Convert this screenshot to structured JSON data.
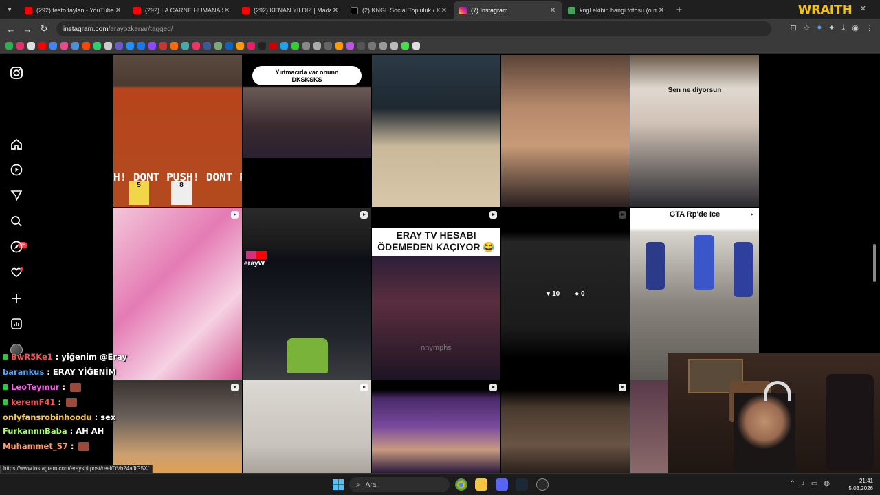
{
  "browser": {
    "tabs": [
      {
        "title": "(292) testo taylan - YouTube",
        "color": "#ff0000"
      },
      {
        "title": "(292) LA CARNE HUMANA SE C",
        "color": "#ff0000"
      },
      {
        "title": "(292) KENAN YILDIZ | Madara C",
        "color": "#ff0000"
      },
      {
        "title": "(2) KNGL Social Topluluk / X",
        "color": "#000000"
      },
      {
        "title": "(7) Instagram",
        "color": "#e1306c"
      },
      {
        "title": "kngl ekibin hangi fotosu (o mu",
        "color": "#46a35e"
      }
    ],
    "close_glyph": "✕",
    "new_tab": "+",
    "url_host": "instagram.com",
    "url_path": "/erayozkenar/tagged/",
    "overlay_logo": "WRAITH"
  },
  "instagram": {
    "notifications_badge": "9+",
    "grid": {
      "tile_captions": {
        "yirtmacida": "Yırtmacıda var onunn",
        "dksksks": "DKSKSKS",
        "sen_ne_diyorsun": "Sen ne diyorsun",
        "gta_rp": "GTA Rp'de Ice",
        "eray_tv_line1": "ERAY TV HESABI",
        "eray_tv_line2": "ÖDEMEDEN KAÇIYOR 😂",
        "dont_push": "H! DONT PUSH! DONT PU",
        "counter_left": "5",
        "counter_right": "8",
        "eray_tag": "erayW",
        "watermark": "nnymphs"
      },
      "hover": {
        "likes": "10",
        "comments": "0"
      }
    }
  },
  "stream": {
    "chat": [
      {
        "user": "BwR5Ke1",
        "msg": "yiğenim @Eray",
        "color": "#ff4d4d",
        "badge": true,
        "emote": false
      },
      {
        "user": "barankus",
        "msg": "ERAY YİĞENİM",
        "color": "#4da6ff",
        "badge": false,
        "emote": false
      },
      {
        "user": "LeoTeymur",
        "msg": "",
        "color": "#ff5cf0",
        "badge": true,
        "emote": true
      },
      {
        "user": "keremF41",
        "msg": "",
        "color": "#ff4d4d",
        "badge": true,
        "emote": true
      },
      {
        "user": "onlyfansrobinhoodu",
        "msg": "sex",
        "color": "#ffcc33",
        "badge": false,
        "emote": false
      },
      {
        "user": "FurkannnBaba",
        "msg": "AH AH",
        "color": "#a8ff66",
        "badge": false,
        "emote": false
      },
      {
        "user": "Muhammet_S7",
        "msg": "",
        "color": "#ff9966",
        "badge": false,
        "emote": true
      }
    ],
    "status_url": "https://www.instagram.com/erayshitpost/reel/DVb24aJiG5X/"
  },
  "taskbar": {
    "search_placeholder": "Ara",
    "time": "21:41",
    "date": "5.03.2026"
  }
}
